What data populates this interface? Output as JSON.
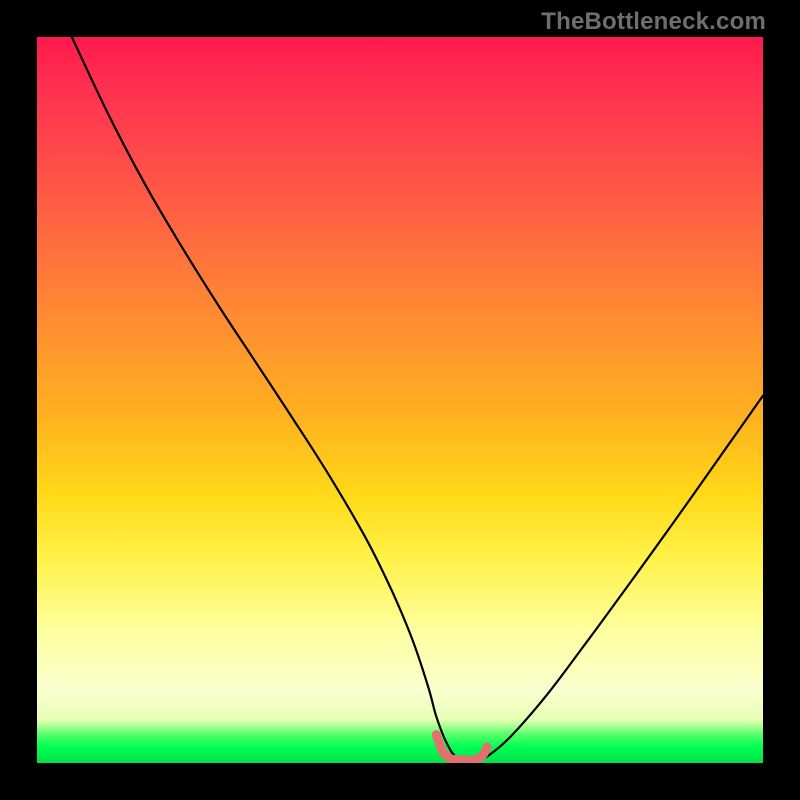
{
  "watermark": "TheBottleneck.com",
  "palette": {
    "curve_stroke": "#000000",
    "highlight_stroke": "#e2716d",
    "background": "#000000"
  },
  "chart_data": {
    "type": "line",
    "title": "",
    "xlabel": "",
    "ylabel": "",
    "xlim": [
      0,
      100
    ],
    "ylim": [
      0,
      100
    ],
    "grid": false,
    "series": [
      {
        "name": "bottleneck-curve",
        "x": [
          4.8,
          10,
          15,
          20,
          25,
          30,
          35,
          40,
          45,
          48,
          50,
          52,
          54,
          55,
          56.5,
          58,
          60,
          61,
          62,
          65,
          70,
          75,
          80,
          85,
          90,
          95,
          100
        ],
        "values": [
          100,
          89,
          79.5,
          71,
          63,
          55.4,
          47.8,
          40,
          31.5,
          25.6,
          21.2,
          16.2,
          10.1,
          6.4,
          2.6,
          0.6,
          0.4,
          0.5,
          0.9,
          3.4,
          9.1,
          15.7,
          22.5,
          29.4,
          36.4,
          43.5,
          50.6
        ]
      },
      {
        "name": "flat-bottom-marker",
        "x": [
          55,
          55.5,
          56,
          57,
          58,
          59,
          60,
          60.5,
          61,
          61.5,
          62
        ],
        "values": [
          3.9,
          2.5,
          1.4,
          0.6,
          0.45,
          0.4,
          0.4,
          0.5,
          0.7,
          1.2,
          2.2
        ]
      }
    ],
    "annotations": [
      {
        "text": "TheBottleneck.com",
        "position": "top-right"
      }
    ]
  }
}
